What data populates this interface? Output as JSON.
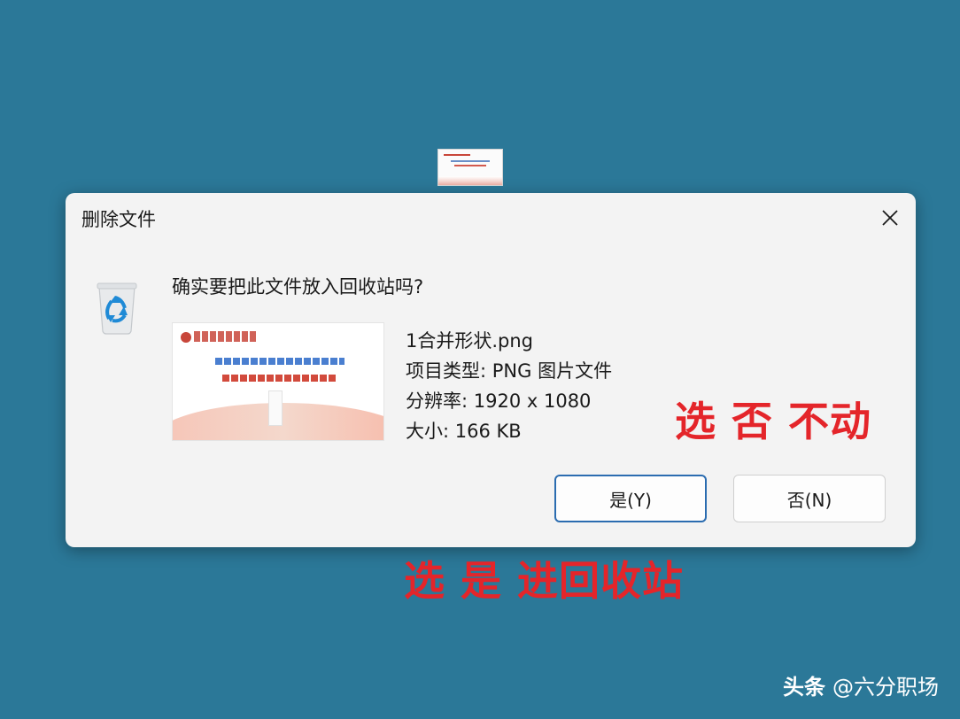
{
  "dialog": {
    "title": "删除文件",
    "question": "确实要把此文件放入回收站吗?",
    "file": {
      "name": "1合并形状.png",
      "type": "项目类型: PNG 图片文件",
      "resolution": "分辨率: 1920 x 1080",
      "size": "大小: 166 KB"
    },
    "buttons": {
      "yes": "是(Y)",
      "no": "否(N)"
    },
    "icons": {
      "close": "close-icon",
      "recycle": "recycle-bin-icon"
    }
  },
  "annotations": {
    "no_note": "选 否 不动",
    "yes_note": "选 是 进回收站"
  },
  "watermark": {
    "left": "头条",
    "right": "@六分职场"
  },
  "colors": {
    "desktop": "#2b7898",
    "annotation": "#e4252a",
    "accent_button_border": "#2b6cb0"
  }
}
